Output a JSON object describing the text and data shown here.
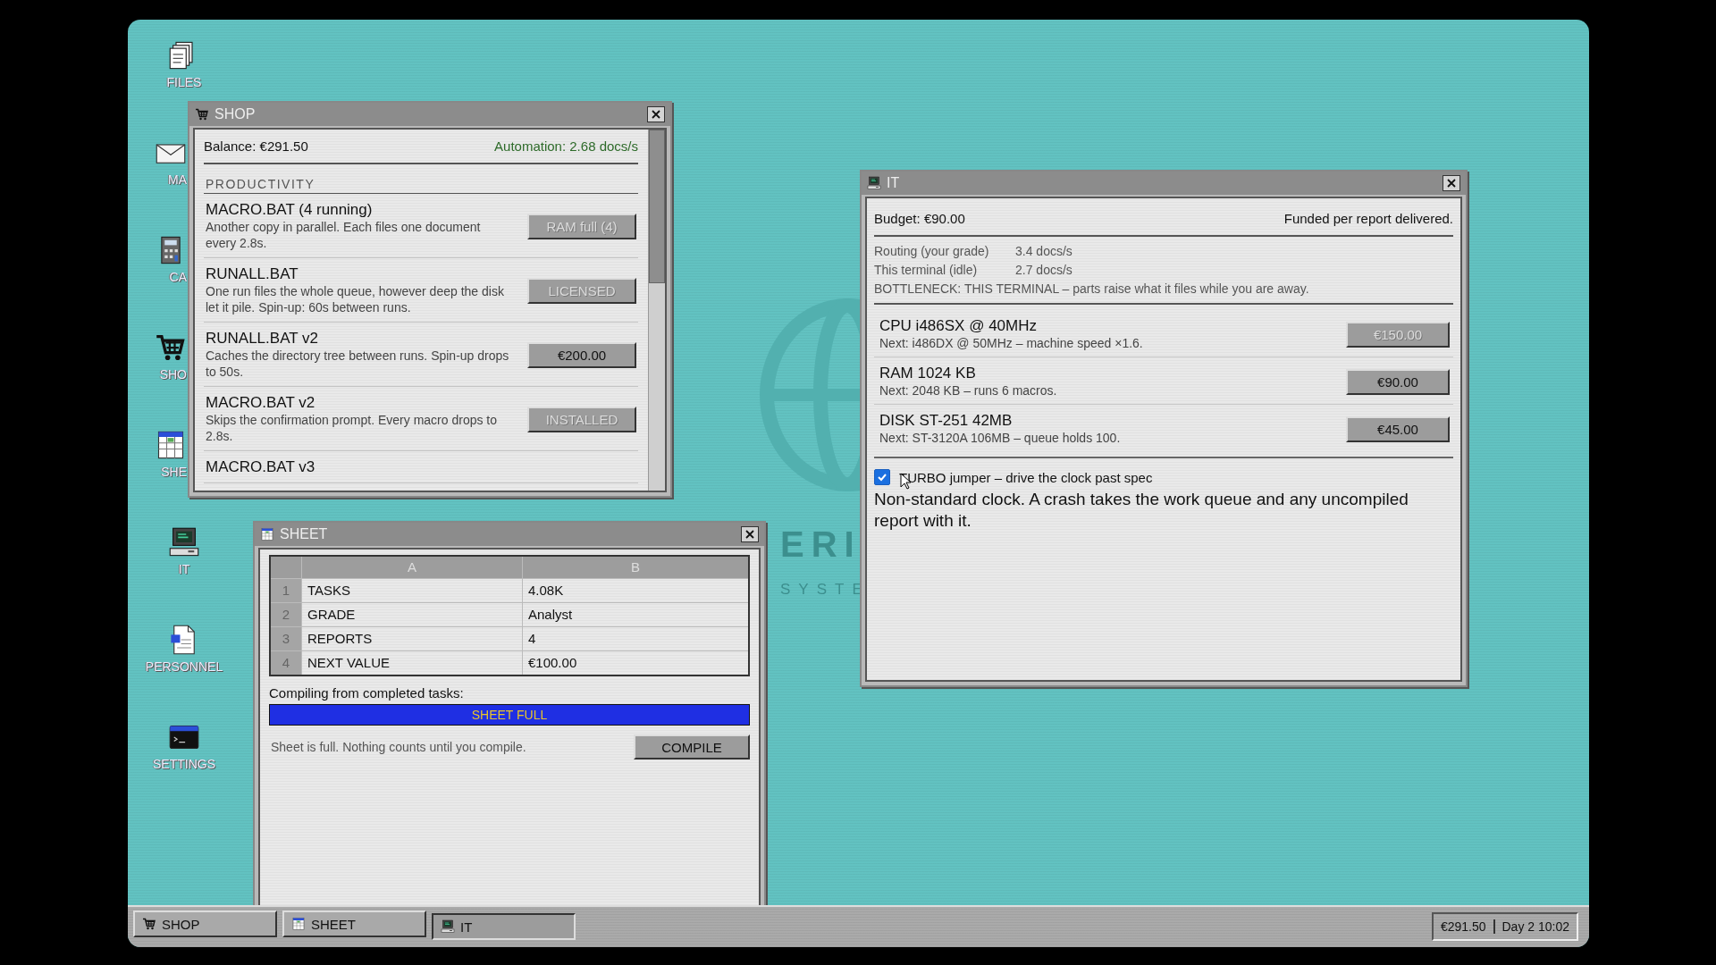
{
  "desktop_icons": [
    {
      "label": "FILES",
      "kind": "files",
      "clipped": false
    },
    {
      "label": "MA",
      "kind": "mail",
      "clipped": true
    },
    {
      "label": "CA",
      "kind": "calculator",
      "clipped": true
    },
    {
      "label": "SHO",
      "kind": "cart",
      "clipped": true
    },
    {
      "label": "SHE",
      "kind": "sheet",
      "clipped": true
    },
    {
      "label": "IT",
      "kind": "computer",
      "clipped": false
    },
    {
      "label": "PERSONNEL",
      "kind": "document",
      "clipped": false
    },
    {
      "label": "SETTINGS",
      "kind": "terminal",
      "clipped": false
    }
  ],
  "wallpaper_logo": {
    "text": "ERI",
    "subtext": "SYSTE"
  },
  "shop_window": {
    "title": "SHOP",
    "balance": "Balance: €291.50",
    "automation": "Automation: 2.68 docs/s",
    "section": "PRODUCTIVITY",
    "items": [
      {
        "name": "MACRO.BAT (4 running)",
        "description": "Another copy in parallel. Each files one document every 2.8s.",
        "button": "RAM full (4)",
        "disabled": true
      },
      {
        "name": "RUNALL.BAT",
        "description": "One run files the whole queue, however deep the disk let it pile. Spin-up: 60s between runs.",
        "button": "LICENSED",
        "disabled": true
      },
      {
        "name": "RUNALL.BAT v2",
        "description": "Caches the directory tree between runs. Spin-up drops to 50s.",
        "button": "€200.00",
        "disabled": false
      },
      {
        "name": "MACRO.BAT v2",
        "description": "Skips the confirmation prompt. Every macro drops to 2.8s.",
        "button": "INSTALLED",
        "disabled": true
      },
      {
        "name": "MACRO.BAT v3"
      }
    ]
  },
  "sheet_window": {
    "title": "SHEET",
    "columns": [
      "A",
      "B"
    ],
    "rows": [
      {
        "number": "1",
        "cells": [
          "TASKS",
          "4.08K"
        ]
      },
      {
        "number": "2",
        "cells": [
          "GRADE",
          "Analyst"
        ]
      },
      {
        "number": "3",
        "cells": [
          "REPORTS",
          "4"
        ]
      },
      {
        "number": "4",
        "cells": [
          "NEXT VALUE",
          "€100.00"
        ]
      }
    ],
    "progress_label": "Compiling from completed tasks:",
    "progress": {
      "level": 1,
      "text": "SHEET FULL"
    },
    "note": "Sheet is full. Nothing counts until you compile.",
    "button": "COMPILE"
  },
  "it_window": {
    "title": "IT",
    "budget": "Budget: €90.00",
    "funding": "Funded per report delivered.",
    "stats": [
      {
        "label": "Routing (your grade)",
        "value": "3.4 docs/s"
      },
      {
        "label": "This terminal (idle)",
        "value": "2.7 docs/s"
      }
    ],
    "bottleneck": "BOTTLENECK: THIS TERMINAL – parts raise what it files while you are away.",
    "parts": [
      {
        "name": "CPU i486SX @ 40MHz",
        "next": "Next: i486DX @ 50MHz – machine speed ×1.6.",
        "button": "€150.00",
        "disabled": true
      },
      {
        "name": "RAM 1024 KB",
        "next": "Next: 2048 KB – runs 6 macros.",
        "button": "€90.00",
        "disabled": false
      },
      {
        "name": "DISK ST-251 42MB",
        "next": "Next: ST-3120A 106MB – queue holds 100.",
        "button": "€45.00",
        "disabled": false
      }
    ],
    "turbo": {
      "label": "TURBO jumper – drive the clock past spec",
      "checked": true
    },
    "warning": "Non-standard clock. A crash takes the work queue and any uncompiled report with it."
  },
  "taskbar": {
    "buttons": [
      {
        "label": "SHOP",
        "kind": "cart",
        "selected": false
      },
      {
        "label": "SHEET",
        "kind": "sheet",
        "selected": false
      },
      {
        "label": "IT",
        "kind": "computer",
        "selected": true
      }
    ],
    "balance": "€291.50",
    "clock": "Day 2 10:02"
  }
}
